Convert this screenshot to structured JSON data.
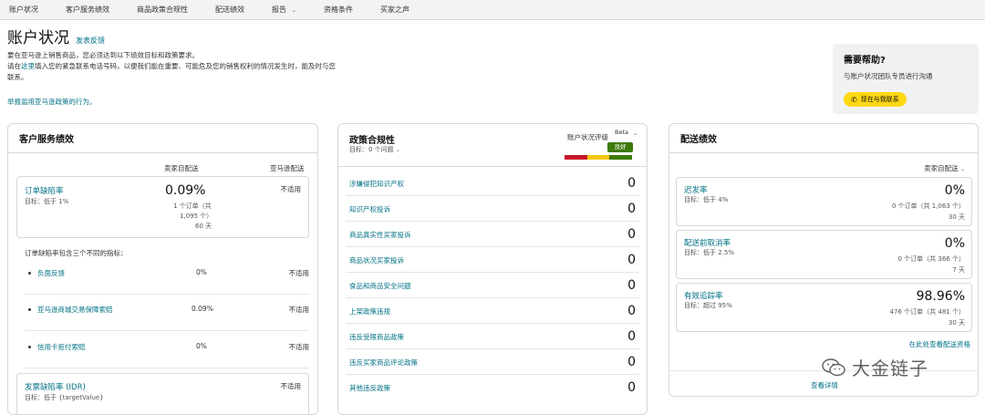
{
  "nav": {
    "items": [
      "账户状况",
      "客户服务绩效",
      "商品政策合规性",
      "配送绩效",
      "报告",
      "资格条件",
      "买家之声"
    ]
  },
  "header": {
    "title": "账户状况",
    "feedback": "发表反馈",
    "desc1": "要在亚马逊上销售商品，您必须达到以下绩效目标和政策要求。",
    "desc2_pre": "请在",
    "desc2_link": "这里",
    "desc2_post": "填入您的紧急联系电话号码，以便我们能在重要、可能危及您的销售权利的情况发生时，能及时与您联系。",
    "report_link": "举报滥用亚马逊政策的行为。"
  },
  "help": {
    "title": "需要帮助?",
    "subtitle": "与账户状况团队专员进行沟通",
    "button": "现在与我联系"
  },
  "customer_service": {
    "title": "客户服务绩效",
    "col_seller": "卖家自配送",
    "col_amazon": "亚马逊配送",
    "odr": {
      "name": "订单缺陷率",
      "target": "目标：低于 1%",
      "value": "0.09%",
      "detail1": "1 个订单（共",
      "detail2": "1,095 个）",
      "detail3": "60 天",
      "amazon": "不适用"
    },
    "intro": "订单缺陷率包含三个不同的指标：",
    "sub_metrics": [
      {
        "label": "负面反馈",
        "seller": "0%",
        "amazon": "不适用"
      },
      {
        "label": "亚马逊商城交易保障索赔",
        "seller": "0.09%",
        "amazon": "不适用"
      },
      {
        "label": "信用卡拒付索赔",
        "seller": "0%",
        "amazon": "不适用"
      }
    ],
    "idr": {
      "name": "发票缺陷率 (IDR)",
      "target": "目标：低于 {targetValue}",
      "amazon": "不适用"
    }
  },
  "policy": {
    "title": "政策合规性",
    "target": "目标：0 个问题",
    "rating_label": "账户状况评级",
    "beta": "Beta",
    "badge": "良好",
    "colors": {
      "red": "#c7162b",
      "yellow": "#f5c70a",
      "green": "#3d7a0a"
    },
    "rows": [
      {
        "label": "涉嫌侵犯知识产权",
        "value": "0"
      },
      {
        "label": "知识产权投诉",
        "value": "0"
      },
      {
        "label": "商品真实性买家投诉",
        "value": "0"
      },
      {
        "label": "商品状况买家投诉",
        "value": "0"
      },
      {
        "label": "食品和商品安全问题",
        "value": "0"
      },
      {
        "label": "上架政策违规",
        "value": "0"
      },
      {
        "label": "违反受限商品政策",
        "value": "0"
      },
      {
        "label": "违反买家商品评论政策",
        "value": "0"
      },
      {
        "label": "其他违反政策",
        "value": "0"
      }
    ]
  },
  "shipping": {
    "title": "配送绩效",
    "filter": "卖家自配送",
    "metrics": [
      {
        "name": "迟发率",
        "target": "目标：低于 4%",
        "value": "0%",
        "detail": "0 个订单（共 1,063 个）",
        "period": "30 天"
      },
      {
        "name": "配送前取消率",
        "target": "目标：低于 2.5%",
        "value": "0%",
        "detail": "0 个订单（共 366 个）",
        "period": "7 天"
      },
      {
        "name": "有效追踪率",
        "target": "目标：超过 95%",
        "value": "98.96%",
        "detail": "476 个订单（共 481 个）",
        "period": "30 天"
      }
    ],
    "more": "在此处查看配送资格",
    "details": "查看详情"
  },
  "watermark": {
    "text": "大金链子"
  }
}
